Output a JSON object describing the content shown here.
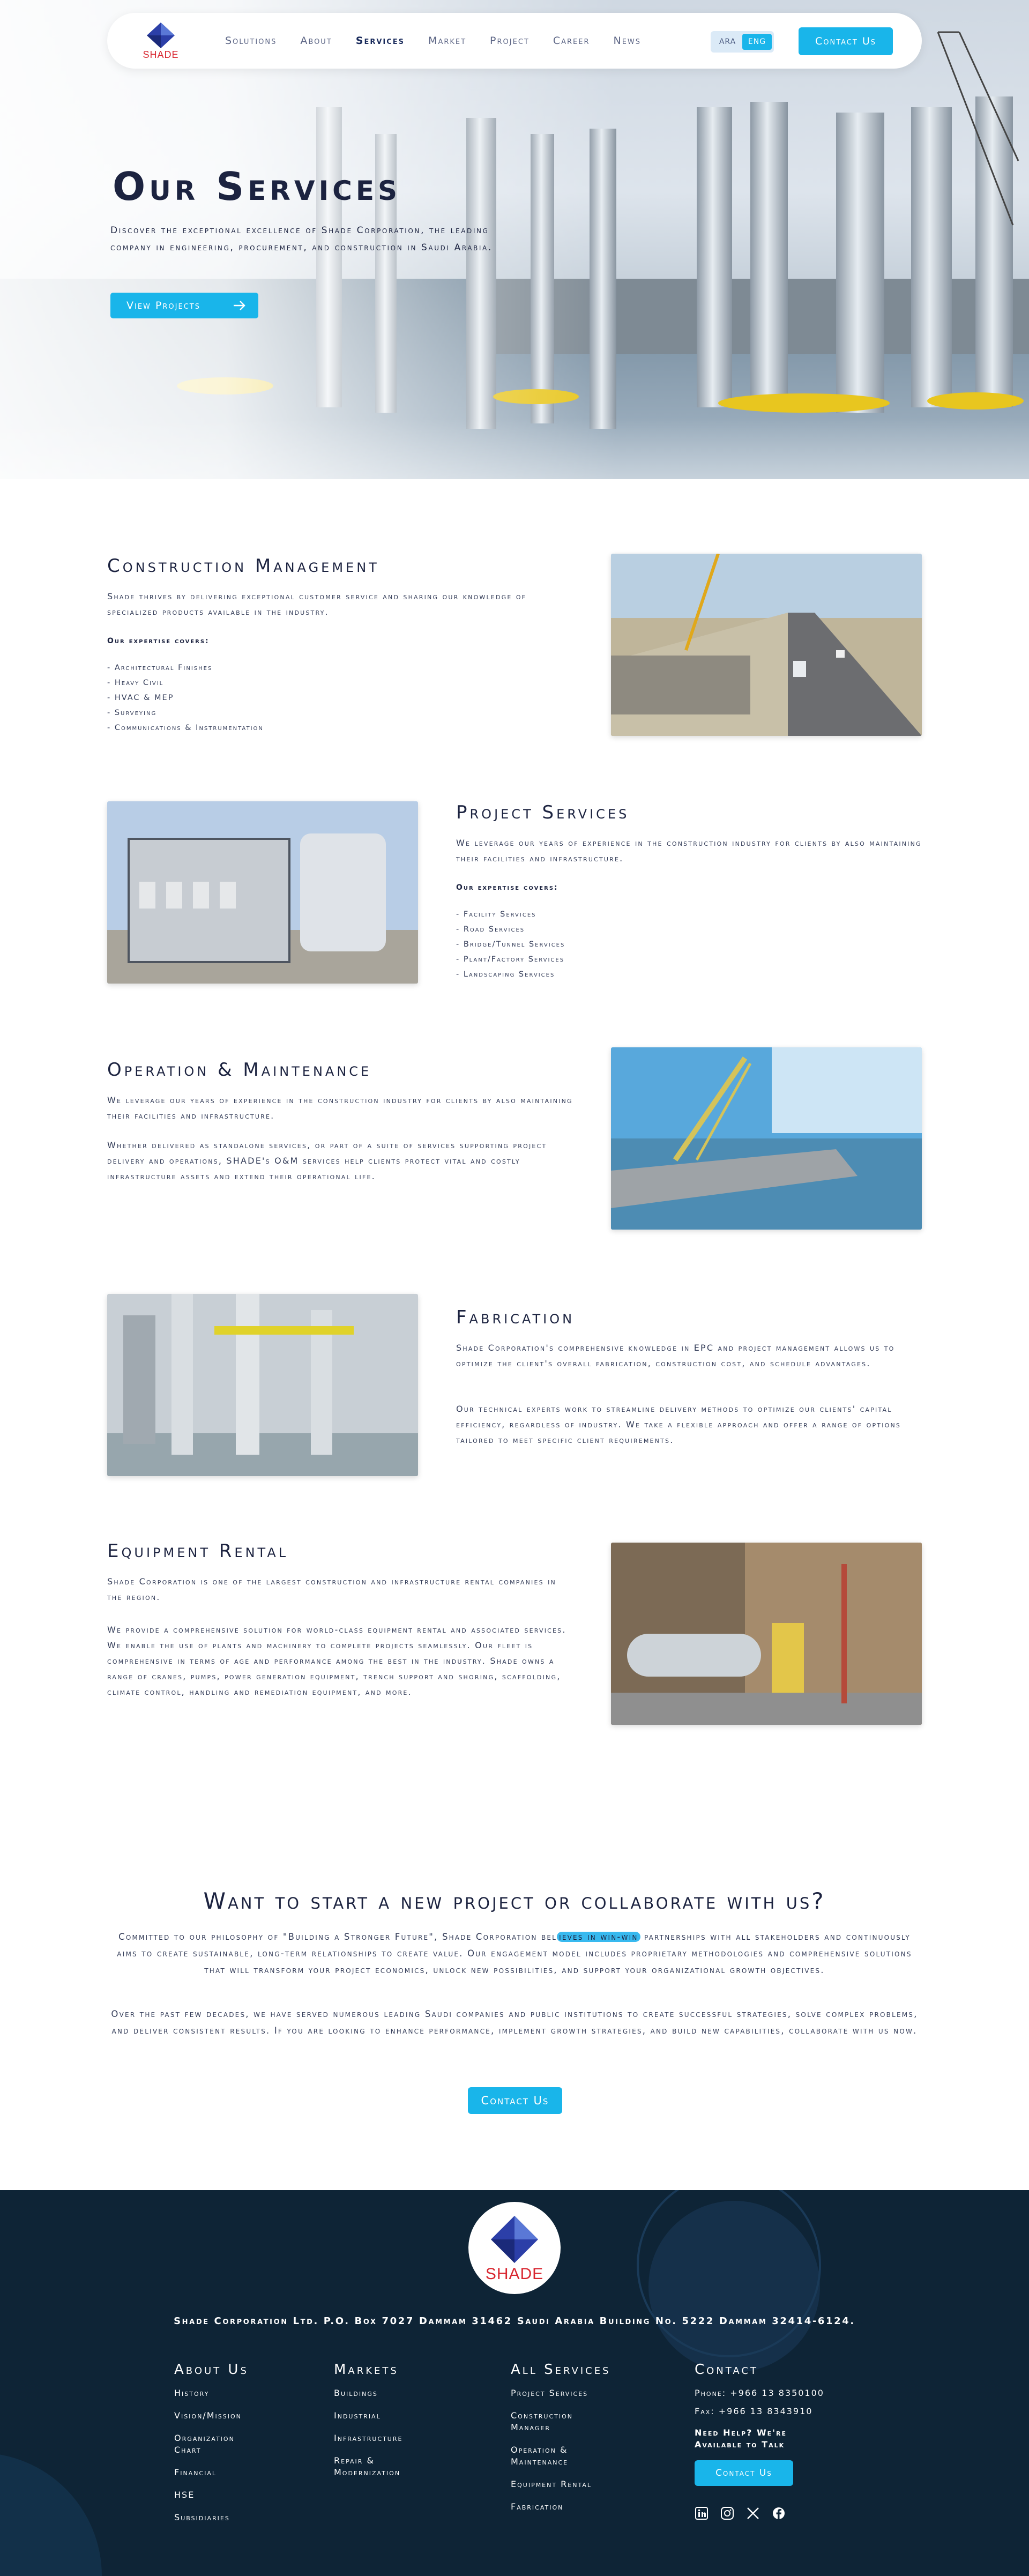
{
  "nav": {
    "logo_text": "SHADE",
    "links": [
      "Solutions",
      "About",
      "Services",
      "Market",
      "Project",
      "Career",
      "News"
    ],
    "active": "Services",
    "lang": {
      "ara": "ARA",
      "eng": "ENG"
    },
    "contact_label": "Contact Us"
  },
  "hero": {
    "title": "Our Services",
    "description": "Discover the exceptional excellence of Shade Corporation, the leading company in engineering, procurement, and construction in Saudi Arabia.",
    "button_label": "View Projects"
  },
  "sections": {
    "construction": {
      "title": "Construction Management",
      "text": "Shade thrives by delivering exceptional customer service and sharing our knowledge of specialized products available in the industry.",
      "expertise_label": "Our expertise covers:",
      "items": [
        "- Architectural Finishes",
        "- Heavy Civil",
        "- HVAC & MEP",
        "- Surveying",
        "- Communications & Instrumentation"
      ]
    },
    "project": {
      "title": "Project Services",
      "text": "We leverage our years of experience in the construction industry for clients by also maintaining their facilities and infrastructure.",
      "expertise_label": "Our expertise covers:",
      "items": [
        "- Facility Services",
        "- Road Services",
        "- Bridge/Tunnel Services",
        "- Plant/Factory Services",
        "- Landscaping Services"
      ]
    },
    "operation": {
      "title": "Operation & Maintenance",
      "text1": "We leverage our years of experience in the construction industry for clients by also maintaining their facilities and infrastructure.",
      "text2": "Whether delivered as standalone services, or part of a suite of services supporting project delivery and operations, SHADE's O&M services help clients protect vital and costly infrastructure assets and extend their operational life."
    },
    "fabrication": {
      "title": "Fabrication",
      "text1": "Shade Corporation's comprehensive knowledge in EPC and project management allows us to optimize the client's overall fabrication, construction cost, and schedule advantages.",
      "text2": "Our technical experts work to streamline delivery methods to optimize our clients' capital efficiency, regardless of industry. We take a flexible approach and offer a range of options tailored to meet specific client requirements."
    },
    "equipment": {
      "title": "Equipment Rental",
      "text1": "Shade Corporation is one of the largest construction and infrastructure rental companies in the region.",
      "text2": "We provide a comprehensive solution for world-class equipment rental and associated services. We enable the use of plants and machinery to complete projects seamlessly. Our fleet is comprehensive in terms of age and performance among the best in the industry. Shade owns a range of cranes, pumps, power generation equipment, trench support and shoring, scaffolding, climate control, handling and remediation equipment, and more."
    }
  },
  "cta": {
    "title": "Want to start a new project or collaborate with us?",
    "p1_before": "Committed to our philosophy of \"Building a Stronger Future\", Shade Corporation bel",
    "p1_highlight": "ieves in win-win",
    "p1_after": " partnerships with all stakeholders and continuously aims to create sustainable, long-term relationships to create value. Our engagement model includes proprietary methodologies and comprehensive solutions that will transform your project economics, unlock new possibilities, and support your organizational growth objectives.",
    "p2": "Over the past few decades, we have served numerous leading Saudi companies and public institutions to create successful strategies, solve complex problems, and deliver consistent results. If you are looking to enhance performance, implement growth strategies, and build new capabilities, collaborate with us now.",
    "button_label": "Contact Us"
  },
  "footer": {
    "logo_text": "SHADE",
    "address": "Shade Corporation Ltd. P.O. Box 7027 Dammam 31462 Saudi Arabia Building No. 5222 Dammam 32414-6124.",
    "about": {
      "title": "About Us",
      "links": [
        "History",
        "Vision/Mission",
        "Organization Chart",
        "Financial",
        "HSE",
        "Subsidiaries"
      ]
    },
    "markets": {
      "title": "Markets",
      "links": [
        "Buildings",
        "Industrial",
        "Infrastructure",
        "Repair & Modernization"
      ]
    },
    "services": {
      "title": "All Services",
      "links": [
        "Project Services",
        "Construction Manager",
        "Operation & Maintenance",
        "Equipment Rental",
        "Fabrication"
      ]
    },
    "contact": {
      "title": "Contact",
      "phone": "Phone: +966 13 8350100",
      "fax": "Fax: +966 13 8343910",
      "help": "Need Help? We're Available to Talk",
      "button_label": "Contact Us"
    },
    "social_icons": [
      "linkedin-icon",
      "instagram-icon",
      "x-icon",
      "facebook-icon"
    ]
  },
  "colors": {
    "accent": "#19b5ea",
    "navy": "#1c2340",
    "footer_bg": "#0e2436",
    "logo_red": "#d8262f",
    "logo_blue": "#2c3fa8"
  }
}
